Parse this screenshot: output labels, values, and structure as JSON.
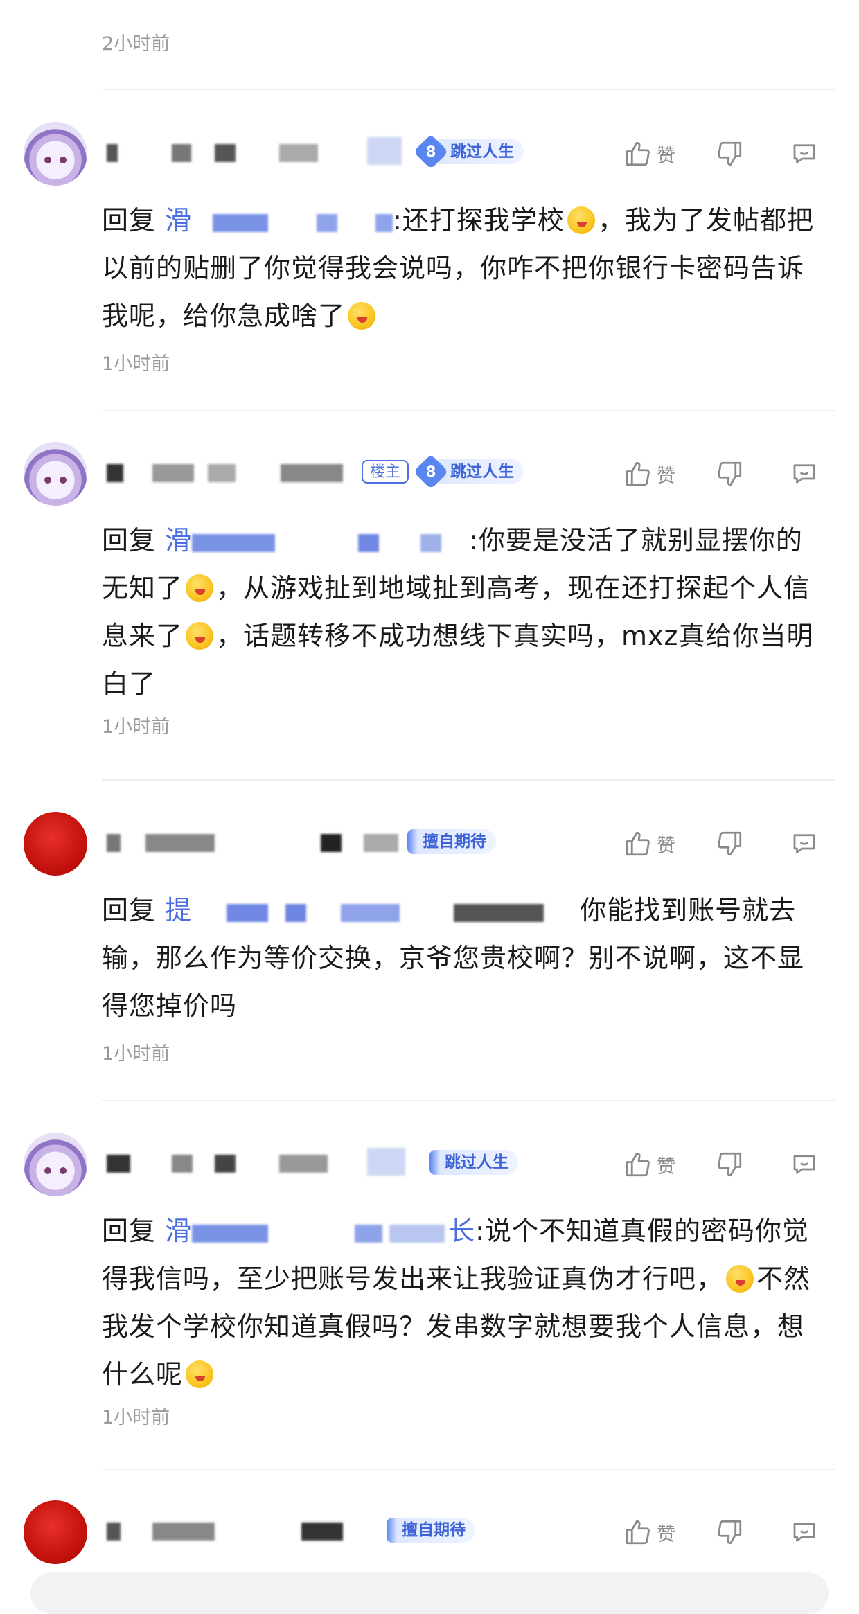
{
  "top": {
    "time": "2小时前"
  },
  "labels": {
    "like": "赞",
    "reply_prefix": "回复",
    "owner_badge": "楼主"
  },
  "comments": [
    {
      "avatar": "anime-girl-avatar",
      "level": "8",
      "title": "跳过人生",
      "is_owner": false,
      "mention_prefix": "滑",
      "mention_suffix": "",
      "text_after": ":还打探我学校",
      "text_rest": "，我为了发帖都把以前的贴删了你觉得我会说吗，你咋不把你银行卡密码告诉我呢，给你急成啥了",
      "time": "1小时前"
    },
    {
      "avatar": "anime-girl-avatar",
      "level": "8",
      "title": "跳过人生",
      "is_owner": true,
      "mention_prefix": "滑",
      "mention_suffix": "",
      "text_after": ":你要是没活了就别显摆你的无知了",
      "text_mid": "，从游戏扯到地域扯到高考，现在还打探起个人信息来了",
      "text_rest": "，话题转移不成功想线下真实吗，mxz真给你当明白了",
      "time": "1小时前"
    },
    {
      "avatar": "red-circle-avatar",
      "level": "",
      "title": "擅自期待",
      "is_owner": false,
      "mention_prefix": "提",
      "mention_suffix": "",
      "text_after": "你能找到账号就去输，那么作为等价交换，京爷您贵校啊？别不说啊，这不显得您掉价吗",
      "time": "1小时前"
    },
    {
      "avatar": "anime-girl-avatar",
      "level": "",
      "title": "跳过人生",
      "is_owner": false,
      "mention_prefix": "滑",
      "mention_suffix": "长",
      "text_after": ":说个不知道真假的密码你觉得我信吗，至少把账号发出来让我验证真伪才行吧，",
      "text_rest": "不然我发个学校你知道真假吗？发串数字就想要我个人信息，想什么呢",
      "time": "1小时前"
    },
    {
      "avatar": "red-circle-avatar",
      "level": "",
      "title": "擅自期待",
      "is_owner": false
    }
  ]
}
